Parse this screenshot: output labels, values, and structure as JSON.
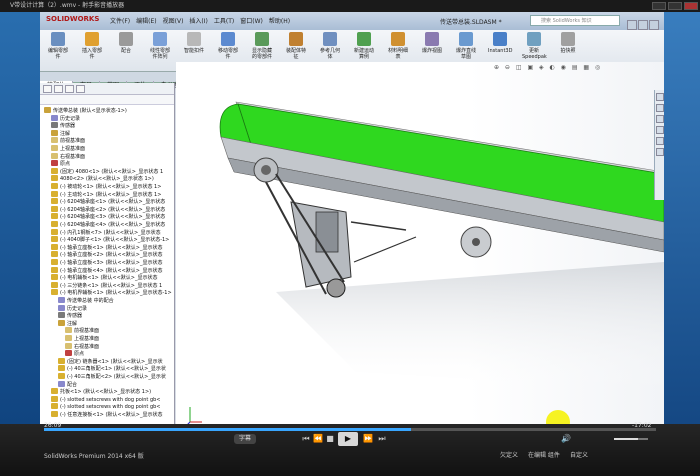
{
  "player": {
    "title": "V带设计计算（2）.wmv - 射手影音播放器",
    "time_current": "26:09",
    "time_remaining": "-17:02",
    "progress": 0.6,
    "volume": 0.7,
    "subtitle_label": "字幕",
    "labels": [
      "欠定义",
      "在编辑 组件",
      "自定义"
    ],
    "status_text": "SolidWorks Premium 2014 x64 版",
    "icons": [
      "prev-icon",
      "rewind-icon",
      "stop-icon",
      "play-icon",
      "forward-icon",
      "next-icon"
    ]
  },
  "sw": {
    "logo": "SOLIDWORKS",
    "menu": [
      "文件(F)",
      "编辑(E)",
      "视图(V)",
      "插入(I)",
      "工具(T)",
      "窗口(W)",
      "帮助(H)"
    ],
    "document": "传送带总装.SLDASM *",
    "search_placeholder": "搜索 SolidWorks 知识",
    "ribbon": [
      {
        "label": "编辑零部件",
        "color": "#6a8fc0"
      },
      {
        "label": "插入零部件",
        "color": "#e0a030"
      },
      {
        "label": "配合",
        "color": "#9a9a9a"
      },
      {
        "label": "线性零部件阵列",
        "color": "#7aa0d8"
      },
      {
        "label": "智能扣件",
        "color": "#b8b8b8"
      },
      {
        "label": "移动零部件",
        "color": "#5c8ad0"
      },
      {
        "label": "显示隐藏的零部件",
        "color": "#5a9a5a"
      },
      {
        "label": "装配体特征",
        "color": "#c08030"
      },
      {
        "label": "参考几何体",
        "color": "#7090c0"
      },
      {
        "label": "新建运动算例",
        "color": "#50a050"
      },
      {
        "label": "材料明细表",
        "color": "#d09030"
      },
      {
        "label": "爆炸视图",
        "color": "#8a7ab0"
      },
      {
        "label": "爆炸直线草图",
        "color": "#6a9ad0"
      },
      {
        "label": "Instant3D",
        "color": "#4a80c8"
      },
      {
        "label": "更新 Speedpak",
        "color": "#70a0c0"
      },
      {
        "label": "拍快照",
        "color": "#a0a0a0"
      }
    ],
    "tabs": [
      "装配体",
      "布局",
      "草图",
      "评估",
      "办公室产品"
    ],
    "view_tools": "⊕ ⊖ ◫ ▣ ◈ ◐ ◉ ▤ ▦ ◎",
    "tree": [
      {
        "label": "传送带总装 (默认<显示状态-1>)",
        "indent": 0,
        "color": "#c9a23a"
      },
      {
        "label": "历史记录",
        "indent": 1,
        "color": "#8888cc"
      },
      {
        "label": "传感器",
        "indent": 1,
        "color": "#7a7a7a"
      },
      {
        "label": "注解",
        "indent": 1,
        "color": "#c9a23a"
      },
      {
        "label": "前视基准面",
        "indent": 1,
        "color": "#d8c070"
      },
      {
        "label": "上视基准面",
        "indent": 1,
        "color": "#d8c070"
      },
      {
        "label": "右视基准面",
        "indent": 1,
        "color": "#d8c070"
      },
      {
        "label": "原点",
        "indent": 1,
        "color": "#c04040"
      },
      {
        "label": "(固定) 4080<1> (默认<<默认>_显示状态 1",
        "indent": 1,
        "color": "#d8b030"
      },
      {
        "label": "4080<2> (默认<<默认>_显示状态 1>)",
        "indent": 1,
        "color": "#d8b030"
      },
      {
        "label": "(-) 被动轮<1> (默认<<默认>_显示状态 1>",
        "indent": 1,
        "color": "#d8b030"
      },
      {
        "label": "(-) 主动轮<1> (默认<<默认>_显示状态 1>",
        "indent": 1,
        "color": "#d8b030"
      },
      {
        "label": "(-) 6204轴承座<1> (默认<<默认>_显示状态",
        "indent": 1,
        "color": "#d8b030"
      },
      {
        "label": "(-) 6204轴承座<2> (默认<<默认>_显示状态",
        "indent": 1,
        "color": "#d8b030"
      },
      {
        "label": "(-) 6204轴承座<3> (默认<<默认>_显示状态",
        "indent": 1,
        "color": "#d8b030"
      },
      {
        "label": "(-) 6204轴承座<4> (默认<<默认>_显示状态",
        "indent": 1,
        "color": "#d8b030"
      },
      {
        "label": "(-) 内孔1钢板<7> (默认<<默认>_显示状态",
        "indent": 1,
        "color": "#d8b030"
      },
      {
        "label": "(-) 4040脚子<1> (默认<<默认>_显示状态-1>",
        "indent": 1,
        "color": "#d8b030"
      },
      {
        "label": "(-) 轴承立座板<1> (默认<<默认>_显示状态",
        "indent": 1,
        "color": "#d8b030"
      },
      {
        "label": "(-) 轴承立座板<2> (默认<<默认>_显示状态",
        "indent": 1,
        "color": "#d8b030"
      },
      {
        "label": "(-) 轴承立座板<3> (默认<<默认>_显示状态",
        "indent": 1,
        "color": "#d8b030"
      },
      {
        "label": "(-) 轴承立座板<4> (默认<<默认>_显示状态",
        "indent": 1,
        "color": "#d8b030"
      },
      {
        "label": "(-) 电机辅板<1> (默认<<默认>_显示状态",
        "indent": 1,
        "color": "#d8b030"
      },
      {
        "label": "(-) 三分链条<1> (默认<<默认>_显示状态 1",
        "indent": 1,
        "color": "#d8b030"
      },
      {
        "label": "(-) 电机界辅板<1> (默认<<默认>_显示状态-1>",
        "indent": 1,
        "color": "#d8b030"
      },
      {
        "label": "传送带总装 中的配合",
        "indent": 2,
        "color": "#8888cc"
      },
      {
        "label": "历史记录",
        "indent": 2,
        "color": "#8888cc"
      },
      {
        "label": "传感器",
        "indent": 2,
        "color": "#7a7a7a"
      },
      {
        "label": "注解",
        "indent": 2,
        "color": "#c9a23a"
      },
      {
        "label": "前视基准面",
        "indent": 3,
        "color": "#d8c070"
      },
      {
        "label": "上视基准面",
        "indent": 3,
        "color": "#d8c070"
      },
      {
        "label": "右视基准面",
        "indent": 3,
        "color": "#d8c070"
      },
      {
        "label": "原点",
        "indent": 3,
        "color": "#c04040"
      },
      {
        "label": "(固定) 链条器<1> (默认<<默认>_显示状",
        "indent": 2,
        "color": "#d8b030"
      },
      {
        "label": "(-) 40三角板配<1> (默认<<默认>_显示状",
        "indent": 2,
        "color": "#d8b030"
      },
      {
        "label": "(-) 40三角板配<2> (默认<<默认>_显示状",
        "indent": 2,
        "color": "#d8b030"
      },
      {
        "label": "配合",
        "indent": 2,
        "color": "#8888cc"
      },
      {
        "label": "托板<1> (默认<<默认>_显示状态 1>)",
        "indent": 1,
        "color": "#d8b030"
      },
      {
        "label": "(-) slotted setscrews with dog point gb<",
        "indent": 1,
        "color": "#d8b030"
      },
      {
        "label": "(-) slotted setscrews with dog point gb<",
        "indent": 1,
        "color": "#d8b030"
      },
      {
        "label": "(-) 任意连接板<1> (默认<<默认>_显示状态",
        "indent": 1,
        "color": "#d8b030"
      }
    ]
  },
  "colors": {
    "belt": "#2fd81f",
    "frame": "#b8bcc0",
    "accent": "#39a6ff"
  }
}
